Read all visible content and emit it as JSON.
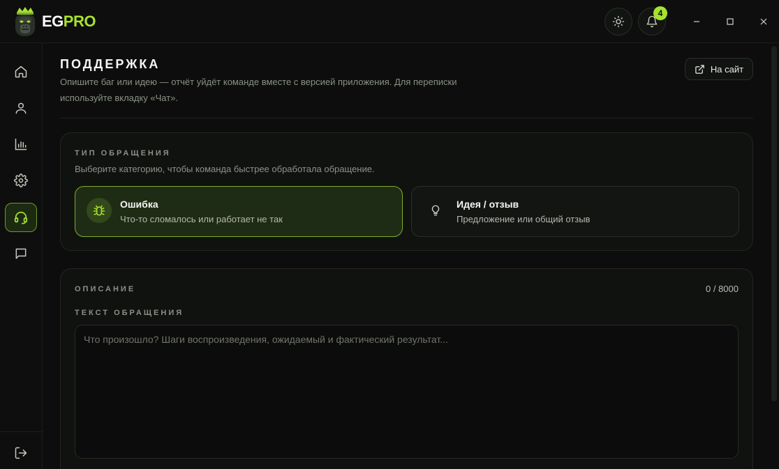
{
  "app": {
    "logo_part1": "EG",
    "logo_part2": "PRO",
    "notifications_count": "4",
    "accent": "#a6e22e"
  },
  "sidebar": {
    "items": [
      {
        "icon": "home-icon"
      },
      {
        "icon": "user-icon"
      },
      {
        "icon": "stats-icon"
      },
      {
        "icon": "gear-icon"
      },
      {
        "icon": "headset-icon",
        "active": true
      },
      {
        "icon": "chat-icon"
      }
    ],
    "logout_icon": "logout-icon"
  },
  "page": {
    "title": "ПОДДЕРЖКА",
    "subtitle": "Опишите баг или идею — отчёт уйдёт команде вместе с версией приложения. Для переписки используйте вкладку «Чат».",
    "site_button": "На сайт"
  },
  "type_section": {
    "label": "ТИП ОБРАЩЕНИЯ",
    "hint": "Выберите категорию, чтобы команда быстрее обработала обращение.",
    "options": [
      {
        "title": "Ошибка",
        "desc": "Что-то сломалось или работает не так",
        "icon": "bug-icon",
        "selected": true
      },
      {
        "title": "Идея / отзыв",
        "desc": "Предложение или общий отзыв",
        "icon": "lightbulb-icon",
        "selected": false
      }
    ]
  },
  "description_section": {
    "label": "ОПИСАНИЕ",
    "counter": "0 / 8000",
    "field_label": "ТЕКСТ ОБРАЩЕНИЯ",
    "placeholder": "Что произошло? Шаги воспроизведения, ожидаемый и фактический результат..."
  }
}
